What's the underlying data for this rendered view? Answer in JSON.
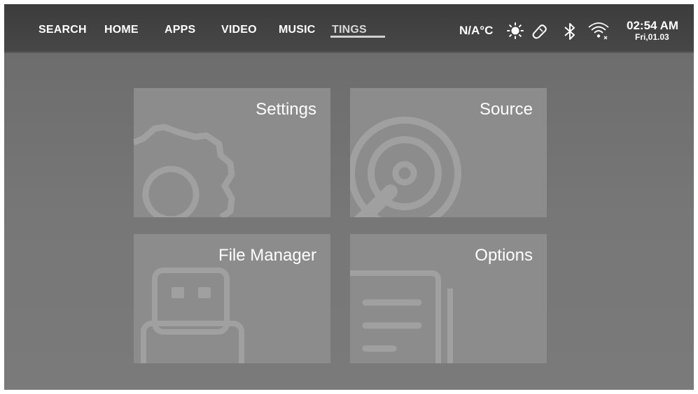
{
  "nav": {
    "items": [
      {
        "label": "SEARCH"
      },
      {
        "label": "HOME"
      },
      {
        "label": "APPS"
      },
      {
        "label": "VIDEO"
      },
      {
        "label": "MUSIC"
      },
      {
        "label": "TINGS",
        "active": true
      }
    ]
  },
  "status": {
    "temperature": "N/A°C",
    "time": "02:54 AM",
    "date": "Fri,01.03",
    "icons": [
      "sun-icon",
      "remote-icon",
      "bluetooth-icon",
      "wifi-icon"
    ]
  },
  "tiles": [
    {
      "label": "Settings",
      "icon": "gear-icon"
    },
    {
      "label": "Source",
      "icon": "source-icon"
    },
    {
      "label": "File Manager",
      "icon": "usb-drive-icon"
    },
    {
      "label": "Options",
      "icon": "document-icon"
    }
  ],
  "colors": {
    "topbar": "#404040",
    "background": "#707070",
    "tile": "#8c8c8c",
    "text": "#ffffff"
  }
}
